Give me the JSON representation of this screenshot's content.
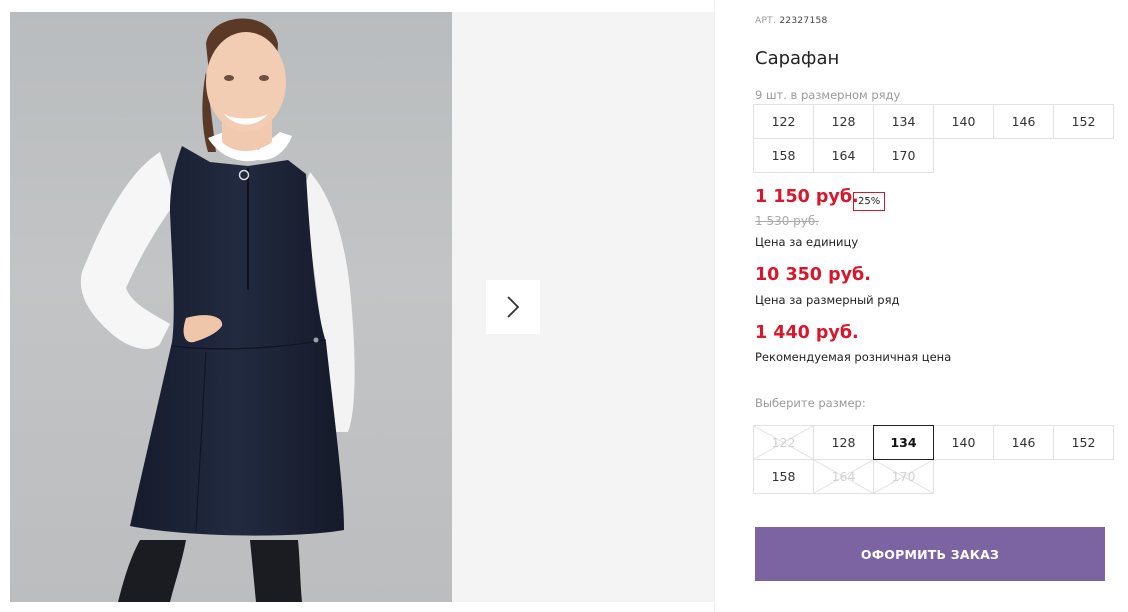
{
  "product": {
    "article_label": "АРТ.",
    "article_number": "22327158",
    "title": "Сарафан",
    "series_label": "9 шт. в размерном ряду",
    "series_sizes": [
      "122",
      "128",
      "134",
      "140",
      "146",
      "152",
      "158",
      "164",
      "170"
    ],
    "unit_price": "1 150 руб.",
    "discount": "25%",
    "old_price": "1 530 руб.",
    "unit_price_caption": "Цена за единицу",
    "series_price": "10 350 руб.",
    "series_price_caption": "Цена за размерный ряд",
    "retail_price": "1 440 руб.",
    "retail_price_caption": "Рекомендуемая розничная цена",
    "choose_size_label": "Выберите размер:",
    "size_options": [
      {
        "label": "122",
        "available": false,
        "selected": false
      },
      {
        "label": "128",
        "available": true,
        "selected": false
      },
      {
        "label": "134",
        "available": true,
        "selected": true
      },
      {
        "label": "140",
        "available": true,
        "selected": false
      },
      {
        "label": "146",
        "available": true,
        "selected": false
      },
      {
        "label": "152",
        "available": true,
        "selected": false
      },
      {
        "label": "158",
        "available": true,
        "selected": false
      },
      {
        "label": "164",
        "available": false,
        "selected": false
      },
      {
        "label": "170",
        "available": false,
        "selected": false
      }
    ],
    "order_button": "ОФОРМИТЬ ЗАКАЗ"
  },
  "gallery": {
    "next_icon": "chevron-right-icon"
  },
  "colors": {
    "price_red": "#d8172d",
    "button_purple": "#7c64a3",
    "dress_navy": "#1c2236"
  }
}
